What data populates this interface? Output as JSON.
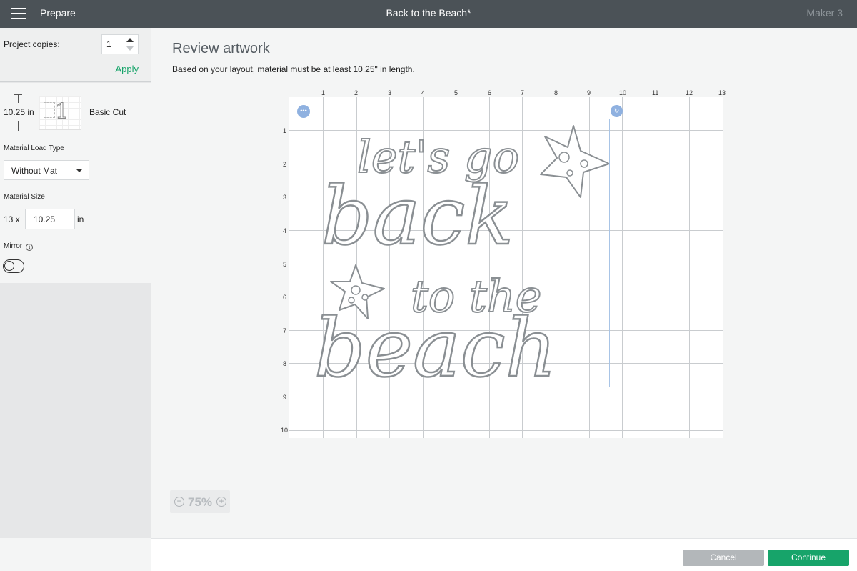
{
  "topbar": {
    "section": "Prepare",
    "title": "Back to the Beach*",
    "machine": "Maker 3"
  },
  "left": {
    "copies_label": "Project copies:",
    "copies_value": "1",
    "apply_label": "Apply",
    "mat_length": "10.25 in",
    "cut_type": "Basic Cut",
    "thumb_number": "1",
    "load_type_label": "Material Load Type",
    "load_type_value": "Without Mat",
    "size_label": "Material Size",
    "size_width": "13 x",
    "size_length": "10.25",
    "size_unit": "in",
    "mirror_label": "Mirror",
    "mirror_on": false
  },
  "main": {
    "heading": "Review artwork",
    "subtitle": "Based on your layout, material must be at least 10.25\" in length.",
    "ruler_top": [
      "1",
      "2",
      "3",
      "4",
      "5",
      "6",
      "7",
      "8",
      "9",
      "10",
      "11",
      "12",
      "13"
    ],
    "ruler_left": [
      "1",
      "2",
      "3",
      "4",
      "5",
      "6",
      "7",
      "8",
      "9",
      "10"
    ],
    "zoom": "75%"
  },
  "footer": {
    "cancel_label": "Cancel",
    "continue_label": "Continue"
  },
  "colors": {
    "topbar": "#4b5257",
    "accent_green": "#17a46a",
    "selection_blue": "#a8c4e6"
  },
  "icons": {
    "menu": "hamburger-icon",
    "more": "more-options-icon",
    "rotate": "rotate-icon",
    "info": "info-icon",
    "zoom_in": "zoom-in-icon",
    "zoom_out": "zoom-out-icon"
  },
  "artwork_text": [
    "let's go",
    "back",
    "to the",
    "beach"
  ]
}
